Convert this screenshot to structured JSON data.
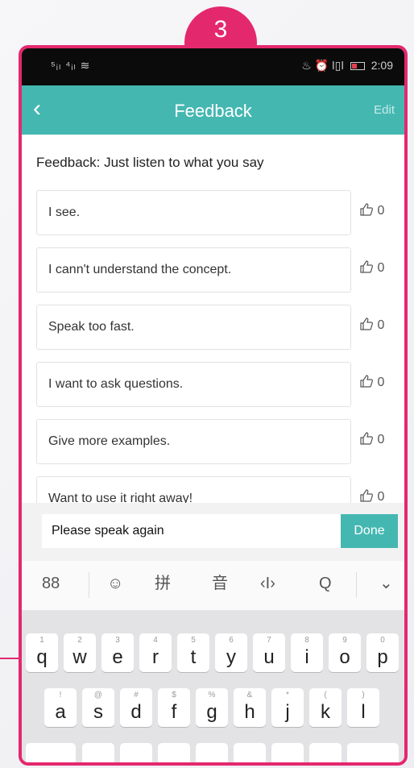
{
  "step_badge": "3",
  "colors": {
    "accent": "#e4286e",
    "teal": "#45b7b1",
    "status_bar": "#0b0b0b"
  },
  "status_bar": {
    "signal": "⁵ᵢₗ ⁴ᵢₗ ≋",
    "indicators": "♨ ⏰ ǀ▯ǀ",
    "time": "2:09"
  },
  "header": {
    "back_icon": "chevron-left",
    "title": "Feedback",
    "edit_label": "Edit"
  },
  "subtitle": "Feedback: Just listen to what you say",
  "feedback_items": [
    {
      "text": "I see.",
      "likes": "0"
    },
    {
      "text": "I cann't understand the concept.",
      "likes": "0"
    },
    {
      "text": "Speak too fast.",
      "likes": "0"
    },
    {
      "text": "I want to ask questions.",
      "likes": "0"
    },
    {
      "text": "Give more examples.",
      "likes": "0"
    },
    {
      "text": "Want to use it right away!",
      "likes": "0"
    }
  ],
  "input": {
    "value": "Please speak again",
    "done_label": "Done"
  },
  "keyboard_toolbar": {
    "grid": "88",
    "emoji": "☺",
    "pinyin": "拼",
    "voice": "音",
    "cursor": "‹I›",
    "search": "Q",
    "collapse": "⌄"
  },
  "keyboard": {
    "row1": [
      {
        "hint": "1",
        "key": "q"
      },
      {
        "hint": "2",
        "key": "w"
      },
      {
        "hint": "3",
        "key": "e"
      },
      {
        "hint": "4",
        "key": "r"
      },
      {
        "hint": "5",
        "key": "t"
      },
      {
        "hint": "6",
        "key": "y"
      },
      {
        "hint": "7",
        "key": "u"
      },
      {
        "hint": "8",
        "key": "i"
      },
      {
        "hint": "9",
        "key": "o"
      },
      {
        "hint": "0",
        "key": "p"
      }
    ],
    "row2": [
      {
        "hint": "!",
        "key": "a"
      },
      {
        "hint": "@",
        "key": "s"
      },
      {
        "hint": "#",
        "key": "d"
      },
      {
        "hint": "$",
        "key": "f"
      },
      {
        "hint": "%",
        "key": "g"
      },
      {
        "hint": "&",
        "key": "h"
      },
      {
        "hint": "*",
        "key": "j"
      },
      {
        "hint": "(",
        "key": "k"
      },
      {
        "hint": ")",
        "key": "l"
      }
    ]
  }
}
